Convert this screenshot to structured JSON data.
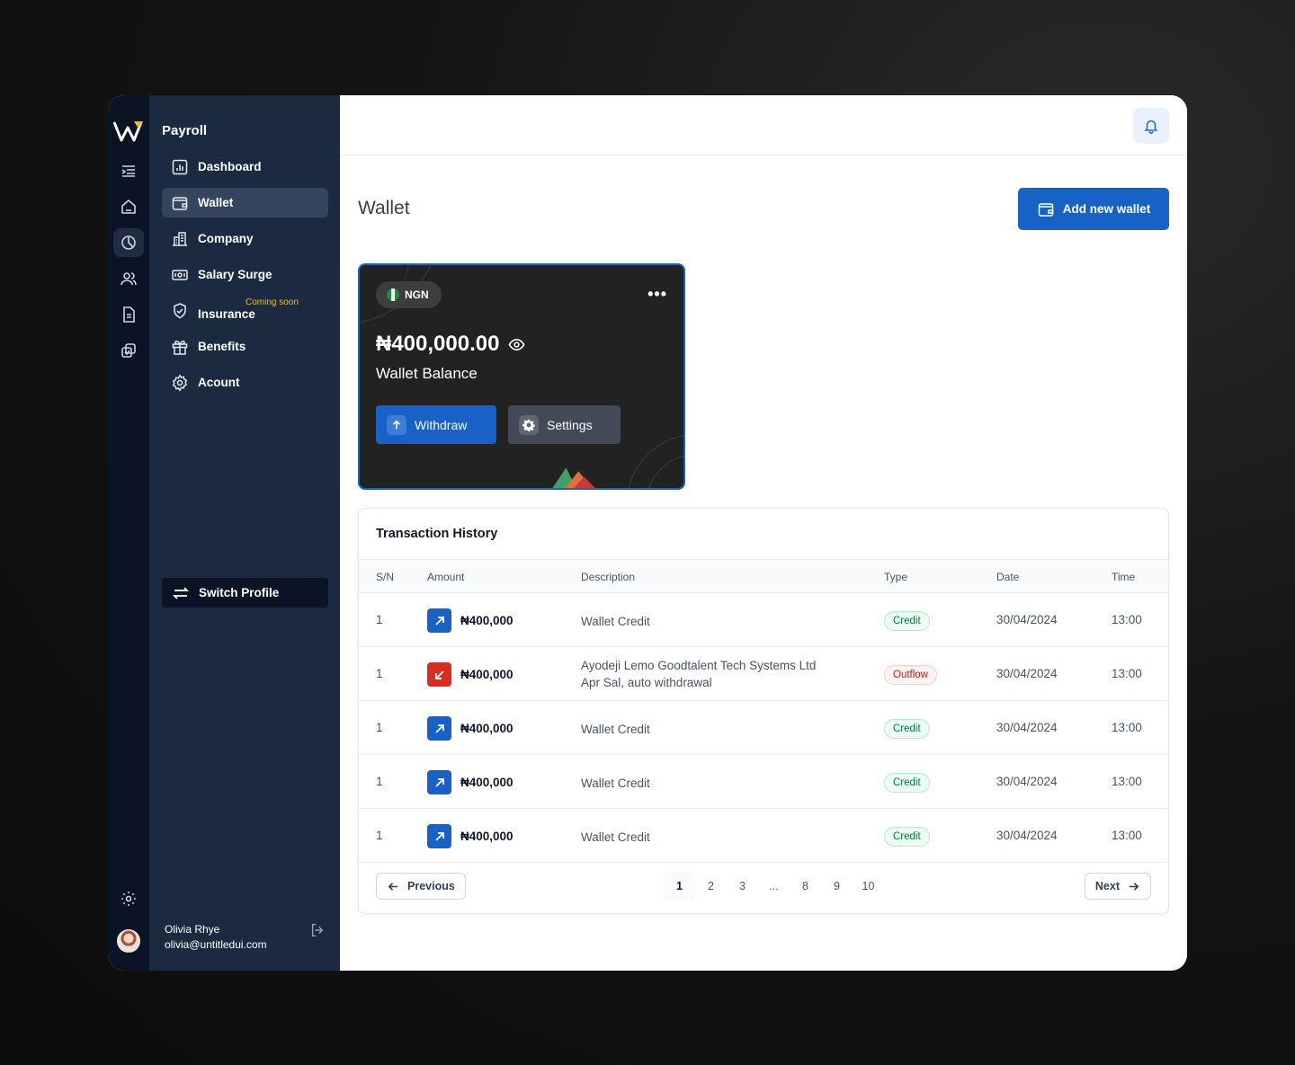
{
  "app": {
    "section_title": "Payroll",
    "page_title": "Wallet"
  },
  "sidebar": {
    "items": [
      {
        "label": "Dashboard",
        "icon": "bar-chart-icon"
      },
      {
        "label": "Wallet",
        "icon": "wallet-icon",
        "active": true
      },
      {
        "label": "Company",
        "icon": "building-icon"
      },
      {
        "label": "Salary Surge",
        "icon": "cash-icon"
      },
      {
        "label": "Insurance",
        "icon": "shield-icon",
        "badge": "Coming soon"
      },
      {
        "label": "Benefits",
        "icon": "gift-icon"
      },
      {
        "label": "Acount",
        "icon": "gear-icon"
      }
    ],
    "switch_profile": "Switch Profile",
    "user": {
      "name": "Olivia Rhye",
      "email": "olivia@untitledui.com"
    }
  },
  "header": {
    "add_wallet_label": "Add new wallet"
  },
  "wallet_card": {
    "currency": "NGN",
    "amount": "₦400,000.00",
    "label": "Wallet Balance",
    "more": "•••",
    "withdraw_label": "Withdraw",
    "settings_label": "Settings"
  },
  "transactions": {
    "title": "Transaction History",
    "columns": [
      "S/N",
      "Amount",
      "Description",
      "Type",
      "Date",
      "Time"
    ],
    "rows": [
      {
        "sn": "1",
        "amount": "₦400,000",
        "direction": "in",
        "description": "Wallet Credit",
        "description2": "",
        "type": "Credit",
        "date": "30/04/2024",
        "time": "13:00"
      },
      {
        "sn": "1",
        "amount": "₦400,000",
        "direction": "out",
        "description": "Ayodeji Lemo Goodtalent Tech Systems Ltd",
        "description2": "Apr Sal, auto withdrawal",
        "type": "Outflow",
        "date": "30/04/2024",
        "time": "13:00"
      },
      {
        "sn": "1",
        "amount": "₦400,000",
        "direction": "in",
        "description": "Wallet Credit",
        "description2": "",
        "type": "Credit",
        "date": "30/04/2024",
        "time": "13:00"
      },
      {
        "sn": "1",
        "amount": "₦400,000",
        "direction": "in",
        "description": "Wallet Credit",
        "description2": "",
        "type": "Credit",
        "date": "30/04/2024",
        "time": "13:00"
      },
      {
        "sn": "1",
        "amount": "₦400,000",
        "direction": "in",
        "description": "Wallet Credit",
        "description2": "",
        "type": "Credit",
        "date": "30/04/2024",
        "time": "13:00"
      }
    ]
  },
  "pagination": {
    "previous": "Previous",
    "next": "Next",
    "pages": [
      "1",
      "2",
      "3",
      "...",
      "8",
      "9",
      "10"
    ],
    "current": "1"
  },
  "colors": {
    "primary": "#1862c7",
    "sidebar": "#1b2a40",
    "rail": "#0b1424",
    "card": "#222222",
    "outflow": "#d92d20"
  }
}
